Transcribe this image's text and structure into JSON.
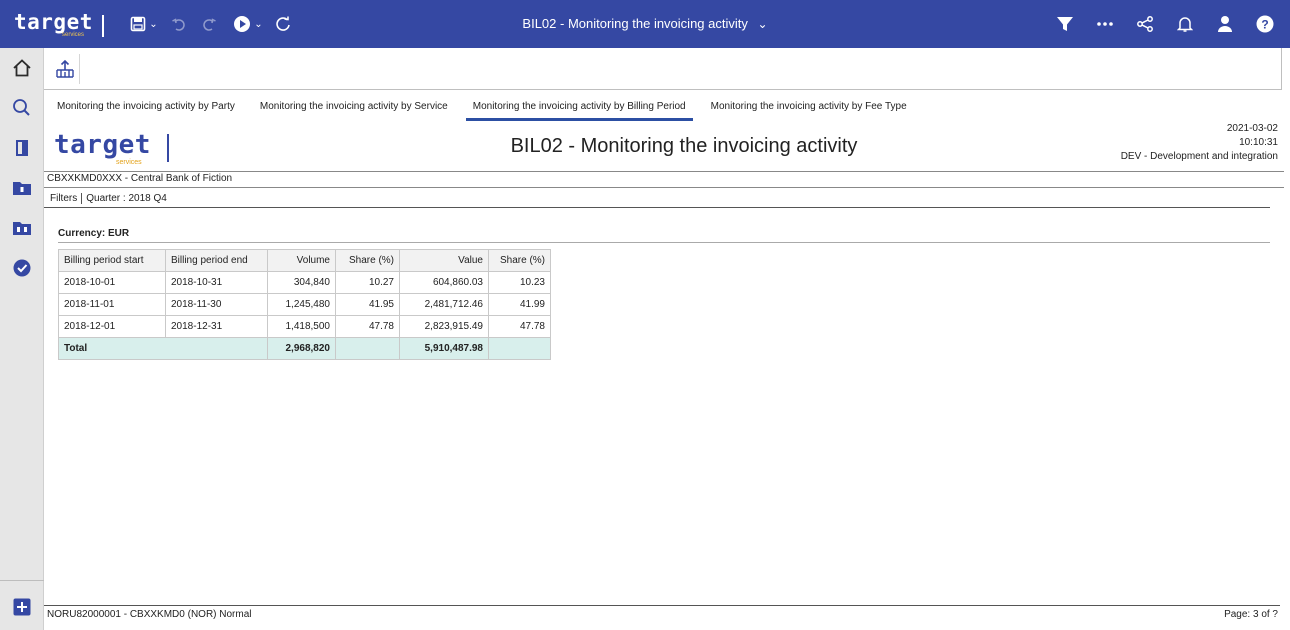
{
  "app": {
    "brand": "target",
    "brand_sub": "services",
    "report_selector": "BIL02 - Monitoring the invoicing activity",
    "accent_color": "#3548a3"
  },
  "toolbar_icons": [
    "save-icon",
    "undo-icon",
    "redo-icon",
    "run-icon",
    "refresh-icon"
  ],
  "right_icons": [
    "filter-icon",
    "more-icon",
    "share-icon",
    "bell-icon",
    "user-icon",
    "help-icon"
  ],
  "sidebar_icons": [
    "home-icon",
    "search-icon",
    "book-icon",
    "folder-icon",
    "team-folder-icon",
    "recent-icon",
    "add-icon"
  ],
  "tabs": [
    {
      "label": "Monitoring the invoicing activity by Party"
    },
    {
      "label": "Monitoring the invoicing activity by Service"
    },
    {
      "label": "Monitoring the invoicing activity by Billing Period"
    },
    {
      "label": "Monitoring the invoicing activity by Fee Type"
    }
  ],
  "active_tab": 2,
  "report": {
    "title": "BIL02 - Monitoring the invoicing activity",
    "date": "2021-03-02",
    "time": "10:10:31",
    "environment": "DEV - Development and integration",
    "bank": "CBXXKMD0XXX - Central Bank of Fiction",
    "filters_label": "Filters",
    "filters_value": "Quarter : 2018 Q4",
    "currency": "Currency: EUR"
  },
  "table": {
    "headers": [
      "Billing period start",
      "Billing period end",
      "Volume",
      "Share (%)",
      "Value",
      "Share (%)"
    ],
    "rows": [
      [
        "2018-10-01",
        "2018-10-31",
        "304,840",
        "10.27",
        "604,860.03",
        "10.23"
      ],
      [
        "2018-11-01",
        "2018-11-30",
        "1,245,480",
        "41.95",
        "2,481,712.46",
        "41.99"
      ],
      [
        "2018-12-01",
        "2018-12-31",
        "1,418,500",
        "47.78",
        "2,823,915.49",
        "47.78"
      ]
    ],
    "total": {
      "label": "Total",
      "volume": "2,968,820",
      "value": "5,910,487.98"
    },
    "total_color": "#d8efec"
  },
  "footer": {
    "left": "NORU82000001 - CBXXKMD0 (NOR) Normal",
    "page": "Page: 3 of ?"
  }
}
